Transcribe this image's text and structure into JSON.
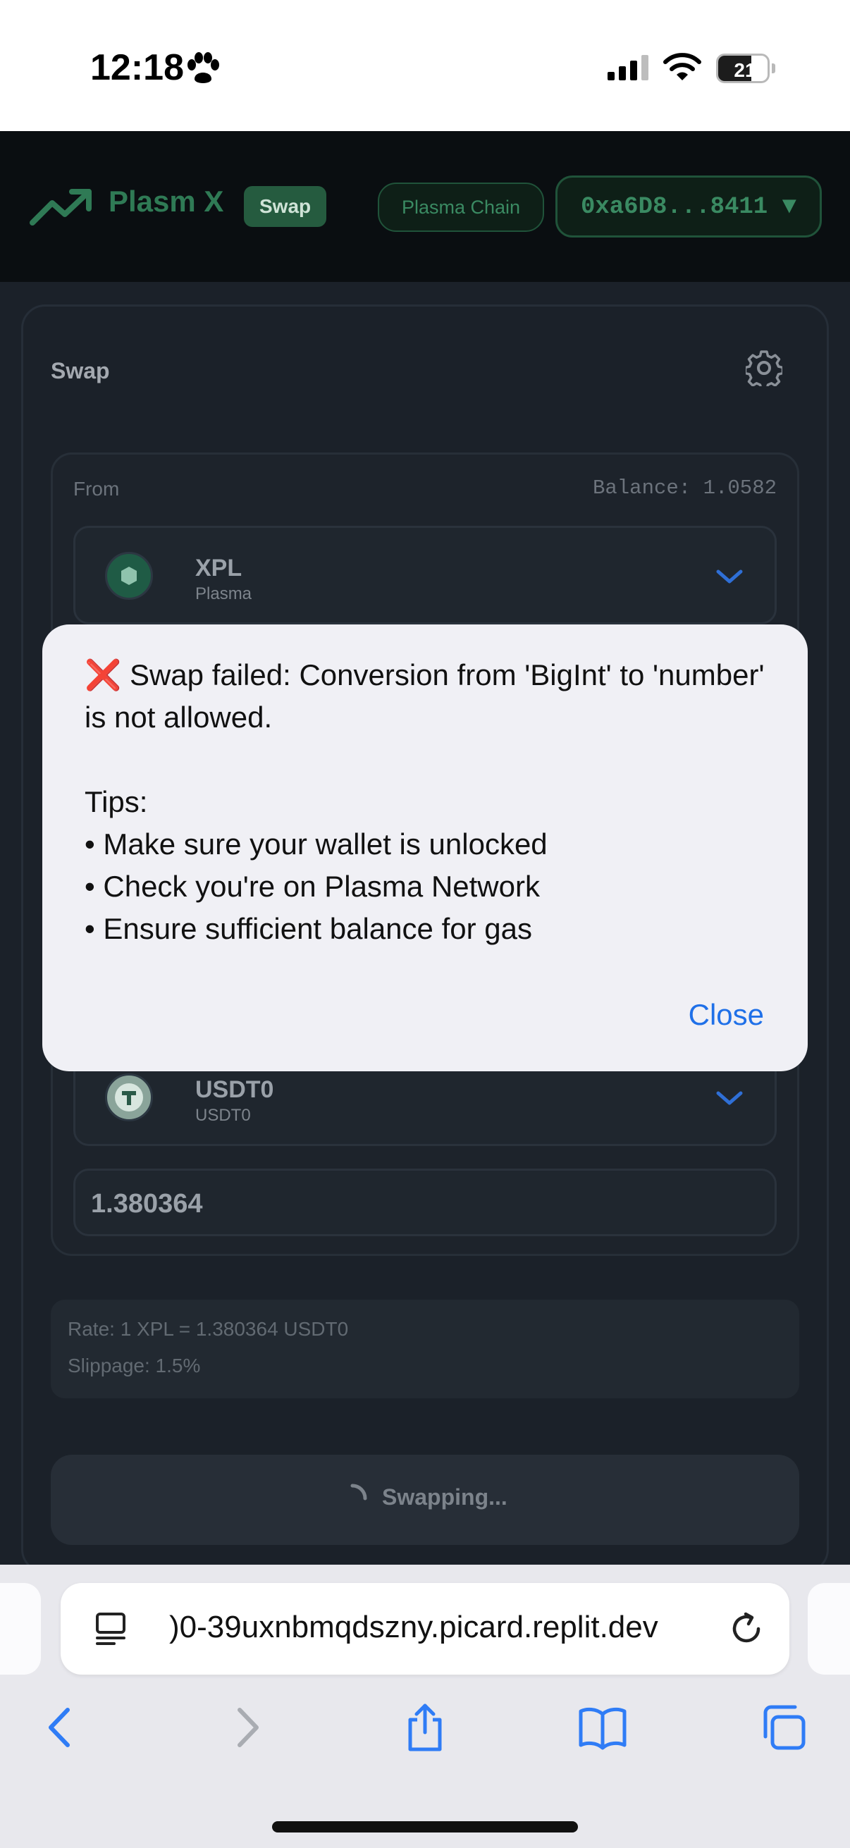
{
  "status_bar": {
    "time": "12:18",
    "battery_level": "21",
    "battery_fraction": 0.21
  },
  "header": {
    "brand": "Plasm X",
    "badge": "Swap",
    "chain": "Plasma Chain",
    "wallet": "0xa6D8...8411 ▼",
    "accent_color": "#2f7a55"
  },
  "swap_card": {
    "title": "Swap",
    "from": {
      "label": "From",
      "balance": "Balance: 1.0582",
      "token_symbol": "XPL",
      "token_name": "Plasma"
    },
    "to": {
      "token_symbol": "USDT0",
      "token_name": "USDT0",
      "amount": "1.380364"
    },
    "info": {
      "rate": "Rate: 1 XPL = 1.380364 USDT0",
      "slippage": "Slippage: 1.5%"
    },
    "button_label": "Swapping..."
  },
  "alert": {
    "icon": "❌",
    "message": " Swap failed: Conversion from 'BigInt' to 'number' is not allowed.\n\nTips:\n• Make sure your wallet is unlocked\n• Check you're on Plasma Network\n• Ensure sufficient balance for gas",
    "close_label": "Close",
    "close_color": "#1f70e8"
  },
  "browser": {
    "url": ")0-39uxnbmqdszny.picard.replit.dev"
  }
}
